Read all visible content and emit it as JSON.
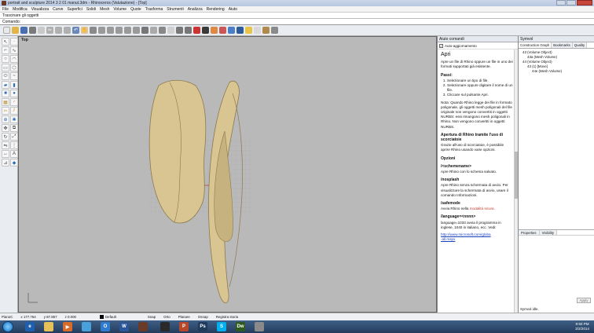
{
  "window": {
    "title": "portrait and sculpture 2014 3 2 01 manut.3dm - Rhinoceros (Valutazione) - [Top]"
  },
  "menu": [
    "File",
    "Modifica",
    "Visualizza",
    "Curve",
    "Superfici",
    "Solidi",
    "Mesh",
    "Volume",
    "Quote",
    "Trasforma",
    "Strumenti",
    "Analizza",
    "Rendering",
    "Aiuto"
  ],
  "command": {
    "history": "Trascinare gli oggetti",
    "prompt": "Comando:"
  },
  "viewport": {
    "label": "Top"
  },
  "help": {
    "header": "Aiuto comandi",
    "autoupdate": "Auto-aggiornamento",
    "title": "Apri",
    "intro": "Apre un file di Rhino oppure un file in uno dei formati supportati già esistente.",
    "steps_title": "Passi:",
    "steps": [
      "Selezionare un tipo di file.",
      "Selezionare oppure digitare il nome di un file.",
      "Cliccare sul pulsante Apri."
    ],
    "note": "Nota: Quando Rhino legge dei file in formato poligonale, gli oggetti mesh poligonali del file originale non vengono convertiti in oggetti NURBS: essi rimangono mesh poligonali in Rhino. Non vengono convertiti in oggetti NURBS.",
    "shortcut_title": "Apertura di Rhino tramite l'uso di scorciatoie",
    "shortcut_text": "Grazie all'uso di scorciatoie, è possibile aprire Rhino usando varie opzioni.",
    "options_title": "Opzioni",
    "opt1_title": "/<schemename>",
    "opt1_text": "Apre Rhino con lo schema salvato.",
    "opt2_title": "/nosplash",
    "opt2_text": "Apre Rhino senza schermata di avvio. Per visualizzare la schermata di avvio, usare il comando Informazioni.",
    "opt3_title": "/safemode",
    "opt3_text_a": "Avvia Rhino nella",
    "opt3_text_b": "modalità sicura.",
    "opt4_title": "/language=<nnnn>",
    "opt4_text": "language=1033 avvia il programma in inglese, 1040 in italiano, ecc. Vedi:",
    "opt4_link": "http://www.microsoft.com/globa",
    "opt4_link2": "-all.mspx"
  },
  "rightpanel": {
    "header": "Symvol",
    "tabs": [
      "Construction Graph",
      "Bookmarks",
      "Quality"
    ],
    "tree": [
      "43 (Volume Object)",
      "43a (Mesh Volume)",
      "44 (Volume Object)",
      "43 (1) [Move]",
      "44e (Mesh Volume)"
    ],
    "tabs2": [
      "Properties",
      "Visibility"
    ],
    "apply": "Apply",
    "status": "Symvol idle."
  },
  "statusbar": {
    "plane": "PianoC",
    "x": "x 177.764",
    "y": "y 87.857",
    "z": "z 0.000",
    "layer": "Default",
    "snap": "Snap",
    "ortho": "Orto",
    "planar": "Planare",
    "osnap": "Osnap",
    "history": "Registra storia"
  },
  "taskbar": {
    "time": "9:50 PM",
    "date": "3/2/2014"
  },
  "colors": {
    "sculpture": "#d9c592",
    "sculpture_dark": "#8c7a4c",
    "viewport_bg": "#b9b9b9"
  }
}
